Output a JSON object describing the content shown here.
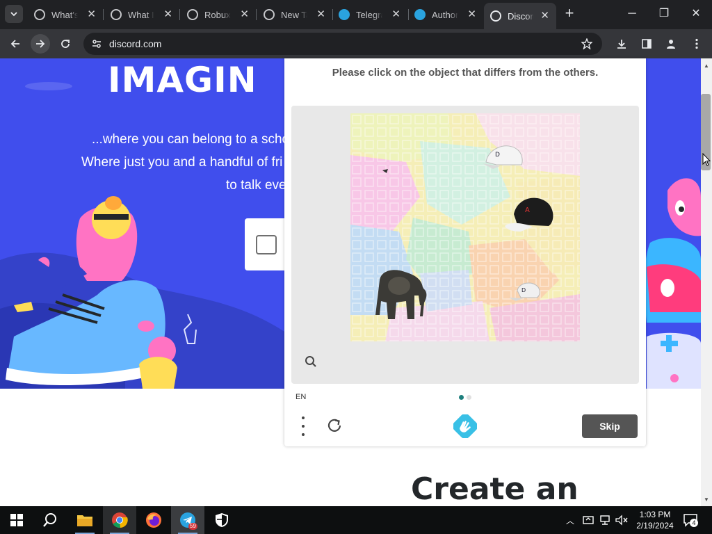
{
  "browser": {
    "tabs": [
      {
        "title": "What's",
        "icon": "chrome-globe-icon",
        "close": "✕"
      },
      {
        "title": "What Is",
        "icon": "chrome-globe-icon",
        "close": "✕"
      },
      {
        "title": "Robux",
        "icon": "chrome-globe-icon",
        "close": "✕"
      },
      {
        "title": "New Tab",
        "icon": "chrome-globe-icon",
        "close": "✕"
      },
      {
        "title": "Telegram",
        "icon": "telegram-icon",
        "close": "✕"
      },
      {
        "title": "Authorization",
        "icon": "telegram-icon",
        "close": "✕"
      },
      {
        "title": "Discord",
        "icon": "chrome-globe-icon",
        "close": "✕"
      }
    ],
    "new_tab": "+",
    "window": {
      "minimize": "─",
      "restore": "❐",
      "close": "✕"
    },
    "url": "discord.com"
  },
  "page": {
    "hero_title": "IMAGIN",
    "hero_lines": [
      "...where you can belong to a scho",
      "Where just you and a handful of fri",
      "to talk eve"
    ],
    "create_title": "Create an"
  },
  "captcha": {
    "prompt": "Please click on the object that differs from the others.",
    "language": "EN",
    "skip_label": "Skip",
    "objects": [
      "baseball-cap-white",
      "baseball-cap-black",
      "baseball-cap-white-small",
      "elephant"
    ],
    "progress_dots": {
      "total": 2,
      "current": 1
    },
    "colors": {
      "accent": "#1e7f7d",
      "skip_bg": "#555555"
    }
  },
  "taskbar": {
    "apps": [
      "windows-start-icon",
      "search-icon",
      "file-explorer-icon",
      "chrome-icon",
      "firefox-icon",
      "telegram-icon",
      "security-shield-icon"
    ],
    "telegram_badge": "59",
    "time": "1:03 PM",
    "date": "2/19/2024",
    "notification_count": "4"
  },
  "colors": {
    "hero_bg": "#404eed",
    "browser_dark": "#202124",
    "browser_toolbar": "#35363a"
  }
}
